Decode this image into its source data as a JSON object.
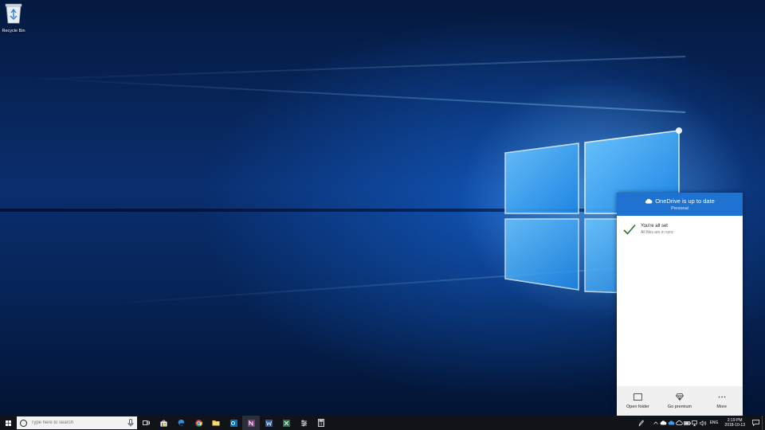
{
  "desktop": {
    "icons": [
      {
        "label": "Recycle Bin",
        "icon": "recycle-bin-icon"
      }
    ]
  },
  "onedrive": {
    "title": "OneDrive is up to date",
    "subtitle": "Personal",
    "status_title": "You're all set",
    "status_detail": "All files are in sync",
    "actions": [
      {
        "label": "Open folder",
        "icon": "folder-icon"
      },
      {
        "label": "Go premium",
        "icon": "diamond-icon"
      },
      {
        "label": "More",
        "icon": "more-icon"
      }
    ],
    "accent": "#1e73d1"
  },
  "taskbar": {
    "search_placeholder": "Type here to search",
    "pinned": [
      "task-view-icon",
      "store-icon",
      "edge-icon",
      "chrome-icon",
      "file-explorer-icon",
      "outlook-icon",
      "onenote-icon",
      "word-icon",
      "excel-icon",
      "settings-icon",
      "calculator-icon"
    ],
    "language": "ENG",
    "time": "2:19 PM",
    "date": "2018-10-13"
  }
}
